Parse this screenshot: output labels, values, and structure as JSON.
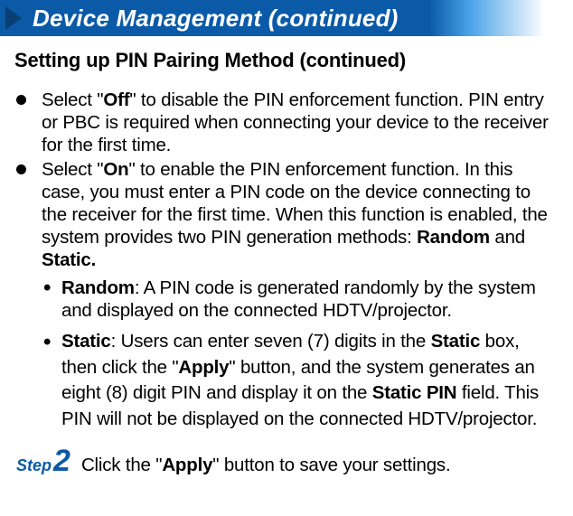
{
  "header": {
    "title": "Device Management (continued)"
  },
  "subheading": "Setting up PIN Pairing Method (continued)",
  "bullets": {
    "off_pre": "Select \"",
    "off_bold": "Off",
    "off_post": "\" to disable the PIN enforcement function. PIN entry or PBC is required when connecting your device to the receiver for the first time.",
    "on_pre": "Select \"",
    "on_bold": "On",
    "on_post1": "\" to enable the PIN enforcement function. In this case, you must enter a PIN code on the device connecting to the receiver for the first time. When this function is en­abled, the system provides two PIN generation methods: ",
    "on_bold2": "Random",
    "on_mid": " and ",
    "on_bold3": "Static."
  },
  "sub_bullets": {
    "random_bold": "Random",
    "random_text": ": A PIN code is generated randomly by the sys­tem and displayed on the connected HDTV/projector.",
    "static_bold1": "Static",
    "static_text1": ": Users can enter seven (7) digits in the ",
    "static_bold2": "Static",
    "static_text2": " box, then click the \"",
    "static_bold3": "Apply",
    "static_text3": "\" button, and the system generates an eight (8) digit PIN and display it on the ",
    "static_bold4": "Static PIN",
    "static_text4": " field. This PIN will not be displayed on the connected HDTV/projector."
  },
  "step": {
    "label": "Step",
    "number": "2",
    "text_pre": "Click the \"",
    "text_bold": "Apply",
    "text_post": "\" button to save your settings."
  }
}
